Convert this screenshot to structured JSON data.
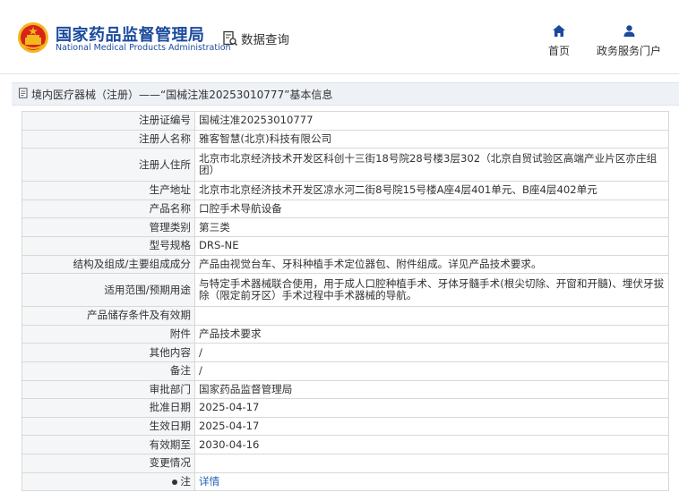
{
  "header": {
    "brand_cn": "国家药品监督管理局",
    "brand_en": "National Medical Products Administration",
    "data_query": "数据查询",
    "nav": [
      {
        "label": "首页",
        "icon": "home-icon"
      },
      {
        "label": "政务服务门户",
        "icon": "user-icon"
      }
    ],
    "brand_color": "#1a4a9c"
  },
  "breadcrumb": {
    "text": "境内医疗器械（注册）——“国械注准20253010777”基本信息"
  },
  "rows": [
    {
      "label": "注册证编号",
      "value": "国械注准20253010777"
    },
    {
      "label": "注册人名称",
      "value": "雅客智慧(北京)科技有限公司"
    },
    {
      "label": "注册人住所",
      "value": "北京市北京经济技术开发区科创十三街18号院28号楼3层302（北京自贸试验区高端产业片区亦庄组团）"
    },
    {
      "label": "生产地址",
      "value": "北京市北京经济技术开发区凉水河二街8号院15号楼A座4层401单元、B座4层402单元"
    },
    {
      "label": "产品名称",
      "value": "口腔手术导航设备"
    },
    {
      "label": "管理类别",
      "value": "第三类"
    },
    {
      "label": "型号规格",
      "value": "DRS-NE"
    },
    {
      "label": "结构及组成/主要组成成分",
      "value": "产品由视觉台车、牙科种植手术定位器包、附件组成。详见产品技术要求。"
    },
    {
      "label": "适用范围/预期用途",
      "value": "与特定手术器械联合使用，用于成人口腔种植手术、牙体牙髓手术(根尖切除、开窗和开髓)、埋伏牙拔除（限定前牙区）手术过程中手术器械的导航。"
    },
    {
      "label": "产品储存条件及有效期",
      "value": ""
    },
    {
      "label": "附件",
      "value": "产品技术要求"
    },
    {
      "label": "其他内容",
      "value": "/"
    },
    {
      "label": "备注",
      "value": "/"
    },
    {
      "label": "审批部门",
      "value": "国家药品监督管理局"
    },
    {
      "label": "批准日期",
      "value": "2025-04-17"
    },
    {
      "label": "生效日期",
      "value": "2025-04-17"
    },
    {
      "label": "有效期至",
      "value": "2030-04-16"
    },
    {
      "label": "变更情况",
      "value": ""
    }
  ],
  "note": {
    "label": "注",
    "link": "详情"
  }
}
